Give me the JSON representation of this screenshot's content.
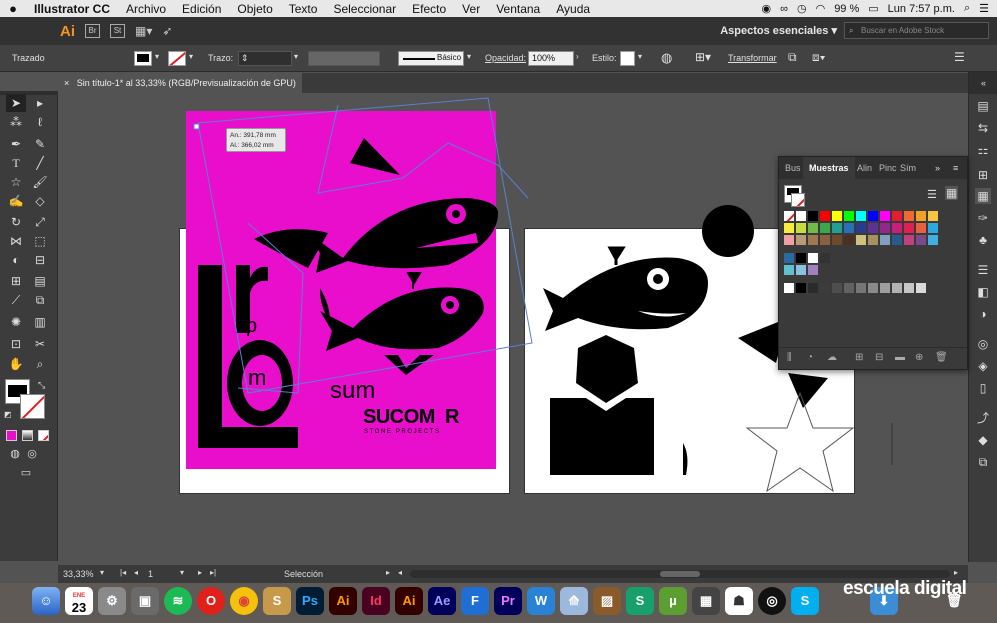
{
  "menubar": {
    "app_name": "Illustrator CC",
    "items": [
      "Archivo",
      "Edición",
      "Objeto",
      "Texto",
      "Seleccionar",
      "Efecto",
      "Ver",
      "Ventana",
      "Ayuda"
    ],
    "battery": "99 %",
    "clock": "Lun 7:57 p.m."
  },
  "appbar": {
    "logo": "Ai",
    "bridge": "Br",
    "stock": "St",
    "workspace": "Aspectos esenciales",
    "search_placeholder": "Buscar en Adobe Stock"
  },
  "control": {
    "mode_label": "Trazado",
    "stroke_label": "Trazo:",
    "brush_label": "Básico",
    "opacity_label": "Opacidad:",
    "opacity_value": "100%",
    "style_label": "Estilo:",
    "transform_label": "Transformar"
  },
  "tab": {
    "title": "Sin título-1* al 33,33% (RGB/Previsualización de GPU)",
    "close": "×"
  },
  "tooltip": {
    "width": "An.: 391,78 mm",
    "height": "Al.: 366,02 mm"
  },
  "artwork": {
    "letters_L": "L",
    "letter_r": "r",
    "letter_p": "p",
    "letter_o": "o",
    "letter_m": "m",
    "word_sum": "sum",
    "brand": "SUCOM  R",
    "tagline": "STONE PROJECTS",
    "colors": {
      "magenta": "#e90ecb",
      "black": "#000000",
      "white": "#ffffff",
      "selection": "#5b7fd1"
    }
  },
  "swatches": {
    "tabs": [
      "Bus",
      "Muestras",
      "Alin",
      "Pinc",
      "Sím"
    ],
    "active_tab": "Muestras",
    "more": "»",
    "menu": "≡"
  },
  "status": {
    "zoom": "33,33%",
    "page": "1",
    "tool": "Selección"
  },
  "dock": {
    "calendar_month": "ENE",
    "calendar_day": "23",
    "apps": [
      "Ps",
      "Ai",
      "Id",
      "Ai",
      "Ae",
      "F",
      "Pr",
      "W",
      "S"
    ]
  },
  "watermark": "escuela digital"
}
